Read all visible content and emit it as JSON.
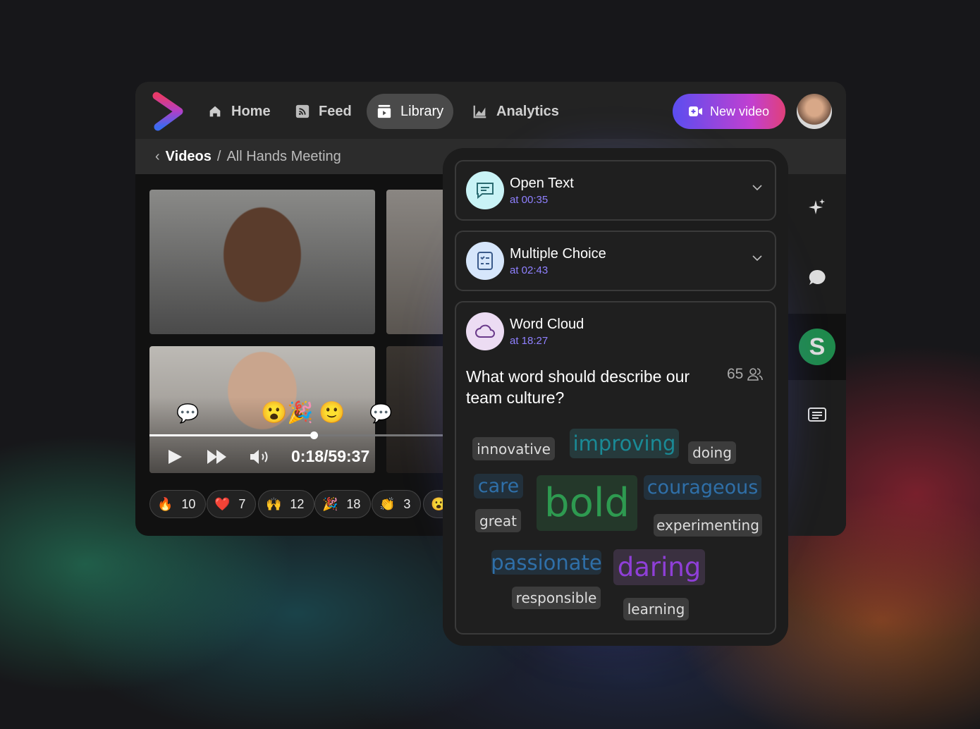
{
  "nav": {
    "items": [
      {
        "label": "Home",
        "icon": "home-icon"
      },
      {
        "label": "Feed",
        "icon": "rss-icon"
      },
      {
        "label": "Library",
        "icon": "library-icon",
        "active": true
      },
      {
        "label": "Analytics",
        "icon": "chart-icon"
      }
    ],
    "new_video": "New video"
  },
  "breadcrumb": {
    "parent": "Videos",
    "separator": "/",
    "current": "All Hands Meeting"
  },
  "player": {
    "time": "0:18/59:37",
    "progress": 0.53
  },
  "reactions": [
    {
      "emoji": "🔥",
      "count": "10"
    },
    {
      "emoji": "❤️",
      "count": "7"
    },
    {
      "emoji": "🙌",
      "count": "12"
    },
    {
      "emoji": "🎉",
      "count": "18"
    },
    {
      "emoji": "👏",
      "count": "3"
    },
    {
      "emoji": "😮",
      "count": ""
    }
  ],
  "overlay_emojis": [
    "😮",
    "🎉",
    "🙂"
  ],
  "sidebar": {
    "avatar_letter": "S",
    "avatar_color": "#1f8a4c"
  },
  "interactions": [
    {
      "title": "Open Text",
      "time": "at 00:35",
      "icon": "message-icon"
    },
    {
      "title": "Multiple Choice",
      "time": "at 02:43",
      "icon": "checklist-icon"
    },
    {
      "title": "Word Cloud",
      "time": "at 18:27",
      "icon": "cloud-icon"
    }
  ],
  "word_cloud": {
    "question": "What word should describe our team culture?",
    "responses": "65",
    "words": [
      "innovative",
      "improving",
      "doing",
      "care",
      "bold",
      "courageous",
      "great",
      "experimenting",
      "passionate",
      "daring",
      "responsible",
      "learning"
    ]
  },
  "colors": {
    "accent": "#8f80ff",
    "teal": "#1a8a96",
    "blue": "#2f6fa8",
    "green": "#2e9a50",
    "purple": "#8f3fd8"
  }
}
